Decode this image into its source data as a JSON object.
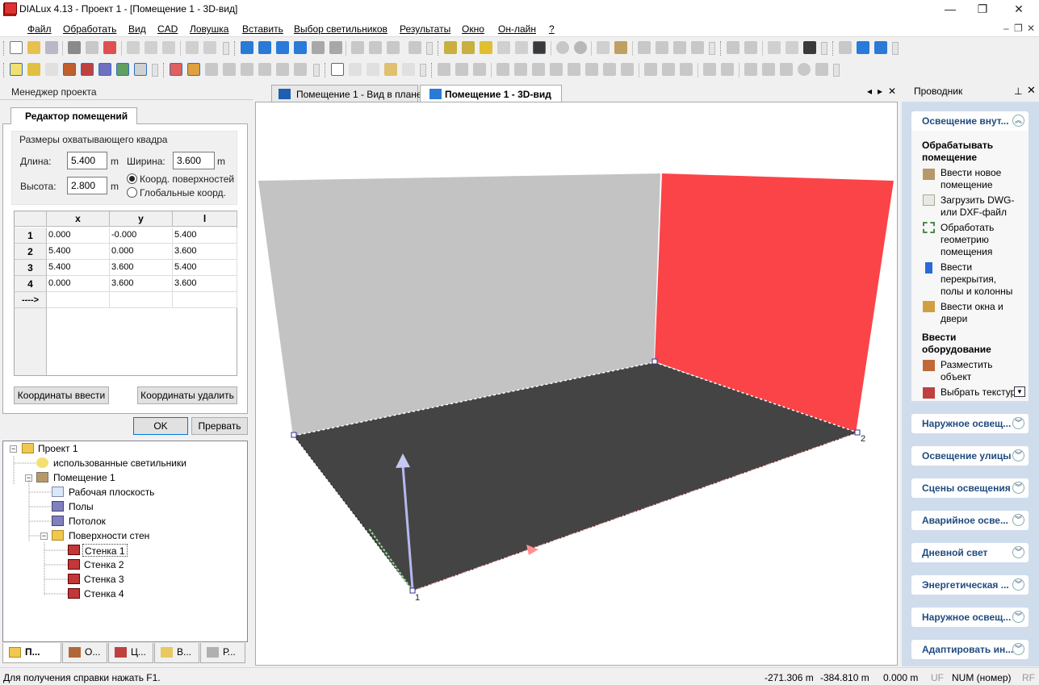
{
  "window": {
    "title": "DIALux 4.13 - Проект 1 - [Помещение 1 - 3D-вид]",
    "min": "—",
    "restore": "❐",
    "close": "✕"
  },
  "menu": [
    "Файл",
    "Обработать",
    "Вид",
    "CAD",
    "Ловушка",
    "Вставить",
    "Выбор светильников",
    "Результаты",
    "Окно",
    "Он-лайн",
    "?"
  ],
  "mdi_controls": {
    "min": "–",
    "restore": "❐",
    "close": "✕"
  },
  "project_manager": {
    "title": "Менеджер проекта"
  },
  "room_editor": {
    "tab": "Редактор помещений",
    "group_title": "Размеры охватывающего квадра",
    "length_label": "Длина:",
    "length_value": "5.400",
    "length_unit": "m",
    "width_label": "Ширина:",
    "width_value": "3.600",
    "width_unit": "m",
    "height_label": "Высота:",
    "height_value": "2.800",
    "height_unit": "m",
    "radio_surface": "Коорд. поверхностей",
    "radio_global": "Глобальные коорд.",
    "columns": [
      "x",
      "y",
      "l"
    ],
    "rows": [
      [
        "1",
        "0.000",
        "-0.000",
        "5.400"
      ],
      [
        "2",
        "5.400",
        "0.000",
        "3.600"
      ],
      [
        "3",
        "5.400",
        "3.600",
        "5.400"
      ],
      [
        "4",
        "0.000",
        "3.600",
        "3.600"
      ]
    ],
    "new_row": "---->",
    "btn_enter": "Координаты ввести",
    "btn_delete": "Координаты удалить",
    "btn_ok": "OK",
    "btn_cancel": "Прервать"
  },
  "tree": [
    {
      "label": "Проект 1",
      "icon": "folder-icon"
    },
    {
      "label": "использованные светильники",
      "icon": "luminaires-icon"
    },
    {
      "label": "Помещение 1",
      "icon": "room-icon"
    },
    {
      "label": "Рабочая плоскость",
      "icon": "workplane-icon"
    },
    {
      "label": "Полы",
      "icon": "floor-icon"
    },
    {
      "label": "Потолок",
      "icon": "ceiling-icon"
    },
    {
      "label": "Поверхности стен",
      "icon": "folder-icon"
    },
    {
      "label": "Стенка 1",
      "icon": "wall-icon"
    },
    {
      "label": "Стенка 2",
      "icon": "wall-icon"
    },
    {
      "label": "Стенка 3",
      "icon": "wall-icon"
    },
    {
      "label": "Стенка 4",
      "icon": "wall-icon"
    }
  ],
  "bottom_tabs": [
    "П...",
    "О...",
    "Ц...",
    "В...",
    "Р..."
  ],
  "doc_tabs": [
    "Помещение 1 - Вид в плане",
    "Помещение 1 - 3D-вид"
  ],
  "doc_nav": {
    "prev": "◂",
    "next": "▸",
    "close": "✕"
  },
  "view_labels": {
    "corner1": "1",
    "corner2": "2"
  },
  "explorer": {
    "title": "Проводник",
    "pin": "⊥",
    "close": "✕",
    "sections": [
      "Освещение внут...",
      "Наружное освещ...",
      "Освещение улицы",
      "Сцены освещения",
      "Аварийное осве...",
      "Дневной свет",
      "Энергетическая ...",
      "Наружное освещ...",
      "Адаптировать ин..."
    ],
    "group1_title": "Обрабатывать помещение",
    "group1_items": [
      "Ввести новое помещение",
      "Загрузить DWG- или DXF-файл",
      "Обработать геометрию помещения",
      "Ввести перекрытия, полы и колонны",
      "Ввести окна и двери"
    ],
    "group2_title": "Ввести оборудование",
    "group2_items": [
      "Разместить объект",
      "Выбрать текстур"
    ]
  },
  "status": {
    "help": "Для получения справки нажать F1.",
    "x": "-271.306 m",
    "y": "-384.810 m",
    "z": "0.000 m",
    "uf": "UF",
    "num": "NUM (номер)",
    "rf": "RF"
  }
}
